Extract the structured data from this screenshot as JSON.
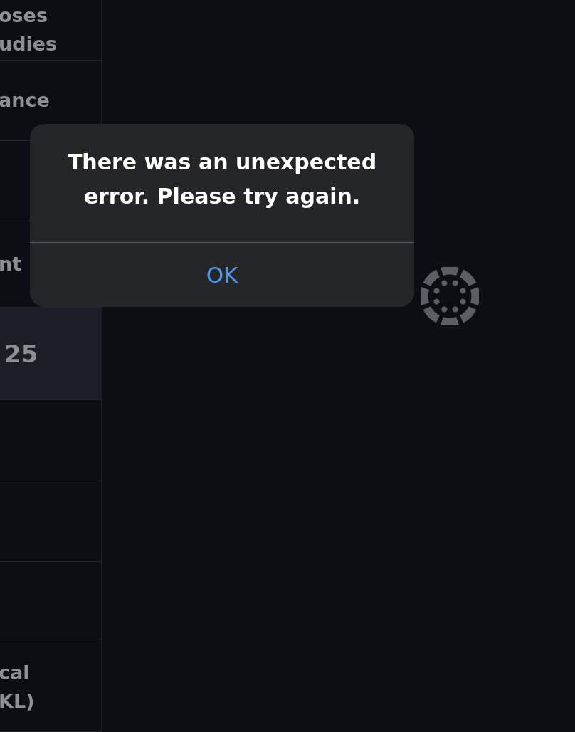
{
  "sidebar": {
    "items": [
      {
        "text": "oses\nudies",
        "highlighted": false
      },
      {
        "text": "ance",
        "highlighted": false
      },
      {
        "highlighted": false
      },
      {
        "text": "nt",
        "highlighted": false
      },
      {
        "text": "25",
        "highlighted": true
      },
      {
        "highlighted": false
      },
      {
        "highlighted": false
      },
      {
        "highlighted": false
      },
      {
        "text": "cal\nKL)",
        "highlighted": false
      }
    ]
  },
  "alert": {
    "message": "There was an unexpected error. Please try again.",
    "buttons": [
      "OK"
    ]
  }
}
